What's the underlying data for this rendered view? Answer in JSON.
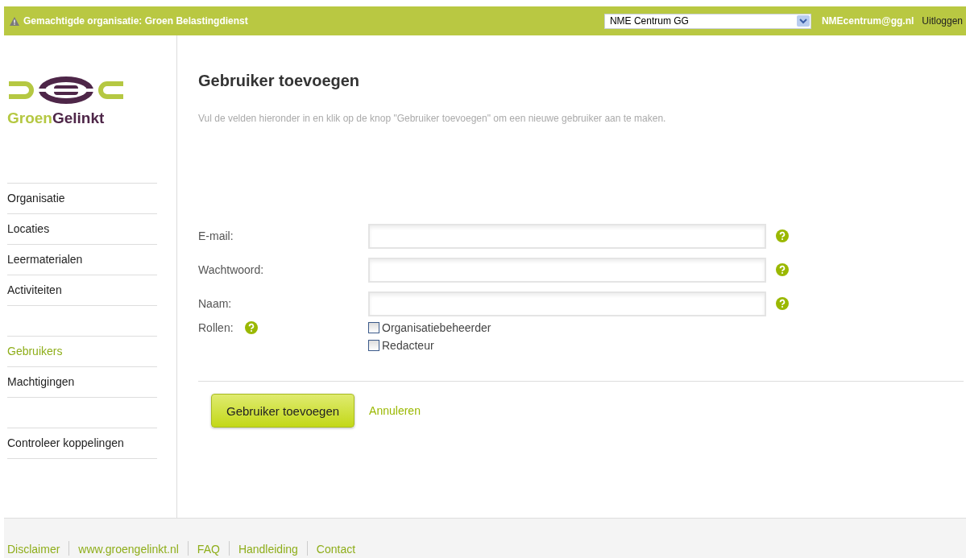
{
  "top_bar": {
    "organisation": "Gemachtigde organisatie: Groen Belastingdienst",
    "select_value": "NME Centrum GG",
    "user": "NMEcentrum@gg.nl",
    "logout": "Uitloggen"
  },
  "logo": {
    "part1": "Groen",
    "part2": "Gelinkt"
  },
  "nav_groups": [
    [
      {
        "label": "Organisatie",
        "selected": false
      },
      {
        "label": "Locaties",
        "selected": false
      },
      {
        "label": "Leermaterialen",
        "selected": false
      },
      {
        "label": "Activiteiten",
        "selected": false
      }
    ],
    [
      {
        "label": "Gebruikers",
        "selected": true
      },
      {
        "label": "Machtigingen",
        "selected": false
      }
    ],
    [
      {
        "label": "Controleer koppelingen",
        "selected": false
      }
    ]
  ],
  "title": "Gebruiker toevoegen",
  "intro": "Vul de velden hieronder in en klik op de knop \"Gebruiker toevoegen\" om een nieuwe gebruiker aan te maken.",
  "fields": [
    {
      "label": "E-mail:"
    },
    {
      "label": "Wachtwoord:"
    },
    {
      "label": "Naam:"
    }
  ],
  "roles": {
    "label": "Rollen:",
    "options": [
      {
        "label": "Organisatiebeheerder",
        "checked": false
      },
      {
        "label": "Redacteur",
        "checked": false
      }
    ]
  },
  "submit": "Gebruiker toevoegen",
  "cancel": "Annuleren",
  "footer_links": [
    "Disclaimer",
    "www.groengelinkt.nl",
    "FAQ",
    "Handleiding",
    "Contact"
  ]
}
